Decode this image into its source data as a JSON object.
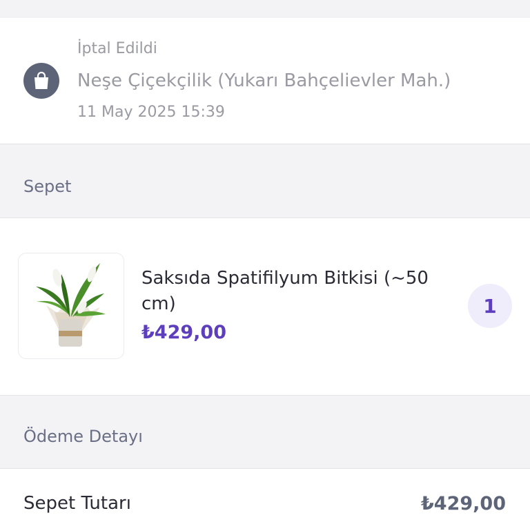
{
  "order": {
    "status": "İptal Edildi",
    "store_name": "Neşe Çiçekçilik (Yukarı Bahçelievler Mah.)",
    "date": "11 May 2025 15:39",
    "icon": "shopping-bag-icon"
  },
  "basket": {
    "section_title": "Sepet",
    "items": [
      {
        "name": "Saksıda Spatifilyum Bitkisi (~50 cm)",
        "price": "₺429,00",
        "quantity": "1",
        "image": "peace-lily-plant-image"
      }
    ]
  },
  "payment": {
    "section_title": "Ödeme Detayı",
    "rows": [
      {
        "label": "Sepet Tutarı",
        "value": "₺429,00"
      }
    ]
  },
  "colors": {
    "accent": "#5d3ebc",
    "icon_bg": "#5e6478",
    "muted_text": "#9a9aa2",
    "section_title": "#6a6f86"
  }
}
